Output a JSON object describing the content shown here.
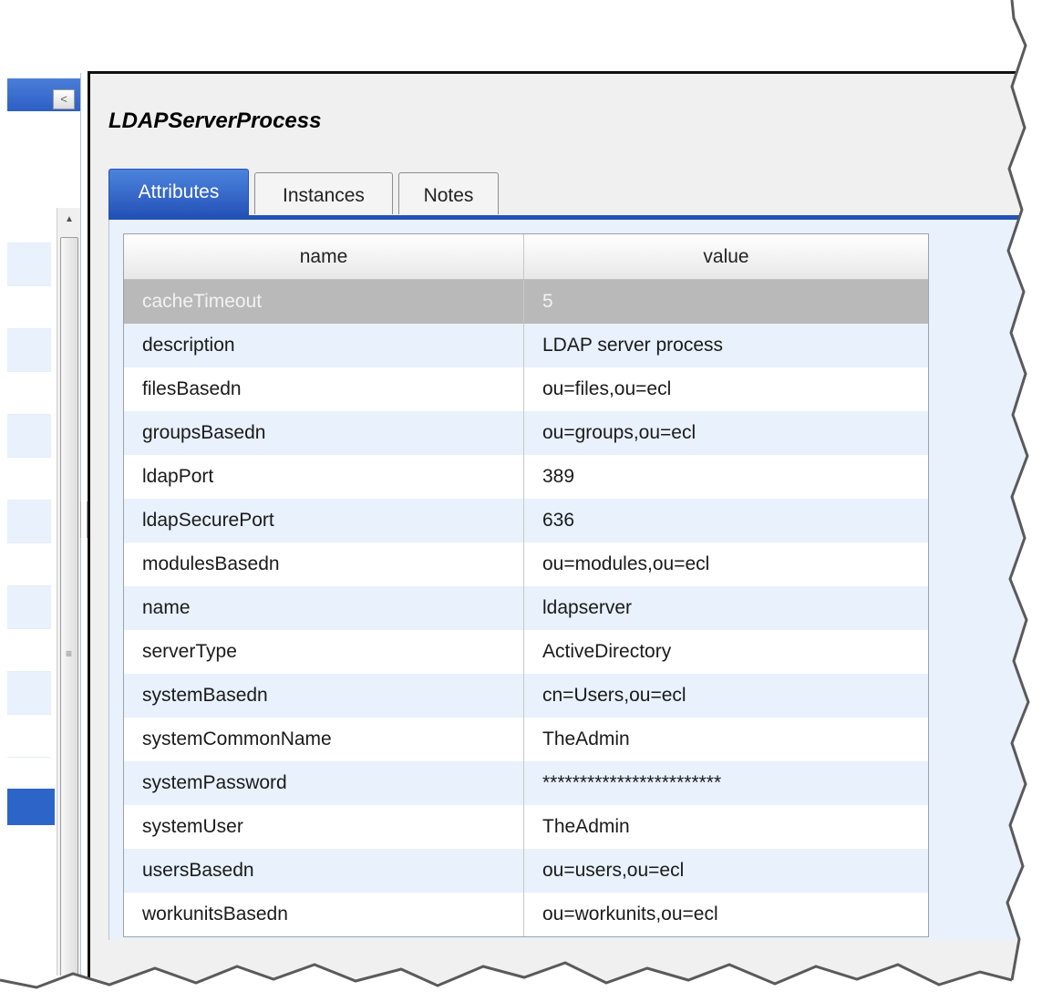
{
  "panel": {
    "title": "LDAPServerProcess"
  },
  "tabs": [
    {
      "label": "Attributes",
      "active": true
    },
    {
      "label": "Instances",
      "active": false
    },
    {
      "label": "Notes",
      "active": false
    }
  ],
  "left_panel": {
    "collapse_icon": "chevron-left-icon",
    "collapse_glyph": "<",
    "scroll_up_glyph": "▲",
    "scroll_down_glyph": "▼",
    "scroll_right_glyph": "▶",
    "grip_glyph": "≡"
  },
  "grid": {
    "columns": [
      "name",
      "value"
    ],
    "rows": [
      {
        "name": "cacheTimeout",
        "value": "5",
        "selected": true
      },
      {
        "name": "description",
        "value": "LDAP server process"
      },
      {
        "name": "filesBasedn",
        "value": "ou=files,ou=ecl"
      },
      {
        "name": "groupsBasedn",
        "value": "ou=groups,ou=ecl"
      },
      {
        "name": "ldapPort",
        "value": "389"
      },
      {
        "name": "ldapSecurePort",
        "value": "636"
      },
      {
        "name": "modulesBasedn",
        "value": "ou=modules,ou=ecl"
      },
      {
        "name": "name",
        "value": "ldapserver"
      },
      {
        "name": "serverType",
        "value": "ActiveDirectory"
      },
      {
        "name": "systemBasedn",
        "value": "cn=Users,ou=ecl"
      },
      {
        "name": "systemCommonName",
        "value": "TheAdmin"
      },
      {
        "name": "systemPassword",
        "value": "************************"
      },
      {
        "name": "systemUser",
        "value": "TheAdmin"
      },
      {
        "name": "usersBasedn",
        "value": "ou=users,ou=ecl"
      },
      {
        "name": "workunitsBasedn",
        "value": "ou=workunits,ou=ecl"
      }
    ]
  },
  "colors": {
    "accent": "#2452b3",
    "row_alt": "#e8f1fc",
    "row_selected": "#b9b9b9"
  }
}
